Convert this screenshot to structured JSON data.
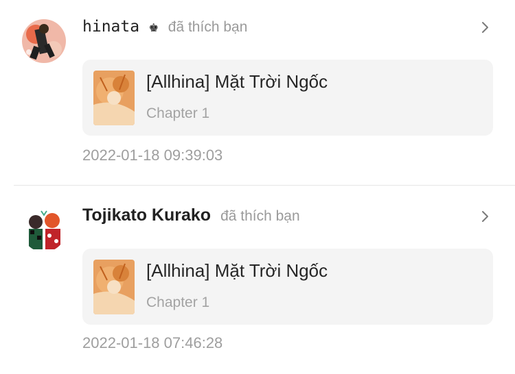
{
  "notifications": [
    {
      "user": "hinata ♚",
      "action": "đã thích bạn",
      "story_title": "[Allhina] Mặt Trời Ngốc",
      "chapter": "Chapter 1",
      "timestamp": "2022-01-18 09:39:03"
    },
    {
      "user": "Tojikato Kurako",
      "action": "đã thích bạn",
      "story_title": "[Allhina] Mặt Trời Ngốc",
      "chapter": "Chapter 1",
      "timestamp": "2022-01-18 07:46:28"
    }
  ],
  "icons": {
    "open": "chevron-right-icon"
  },
  "colors": {
    "card_background": "#f4f4f4",
    "muted_text": "#9e9e9e",
    "primary_text": "#222222"
  }
}
